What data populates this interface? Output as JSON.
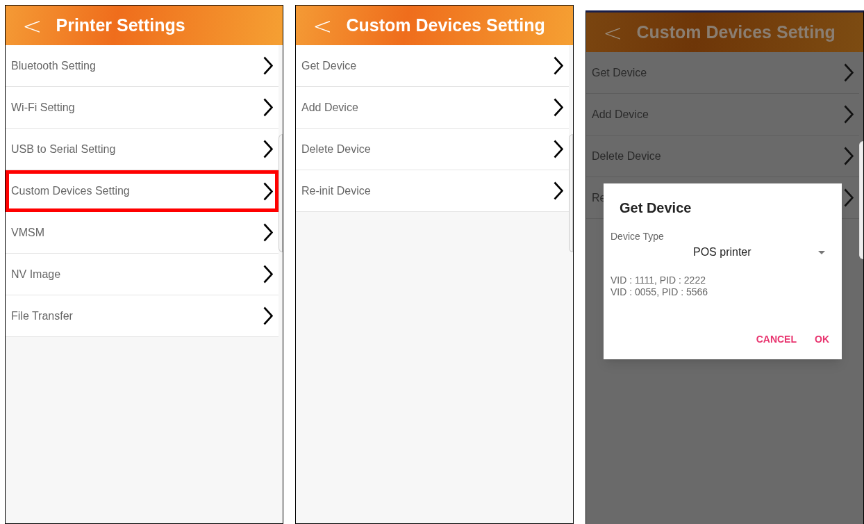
{
  "screens": [
    {
      "title": "Printer Settings",
      "back": "<",
      "dimmed": false,
      "items": [
        {
          "label": "Bluetooth Setting",
          "highlighted": false
        },
        {
          "label": "Wi-Fi Setting",
          "highlighted": false
        },
        {
          "label": "USB to Serial Setting",
          "highlighted": false
        },
        {
          "label": "Custom Devices Setting",
          "highlighted": true
        },
        {
          "label": "VMSM",
          "highlighted": false
        },
        {
          "label": "NV Image",
          "highlighted": false
        },
        {
          "label": "File Transfer",
          "highlighted": false
        }
      ]
    },
    {
      "title": "Custom Devices Setting",
      "back": "<",
      "dimmed": false,
      "items": [
        {
          "label": "Get Device",
          "highlighted": false
        },
        {
          "label": "Add Device",
          "highlighted": false
        },
        {
          "label": "Delete Device",
          "highlighted": false
        },
        {
          "label": "Re-init Device",
          "highlighted": false
        }
      ]
    },
    {
      "title": "Custom Devices Setting",
      "back": "<",
      "dimmed": true,
      "items": [
        {
          "label": "Get Device",
          "highlighted": false
        },
        {
          "label": "Add Device",
          "highlighted": false
        },
        {
          "label": "Delete Device",
          "highlighted": false
        },
        {
          "label": "Re",
          "highlighted": false
        }
      ],
      "dialog": {
        "title": "Get Device",
        "field_label": "Device Type",
        "select_value": "POS printer",
        "lines": [
          "VID : 1111, PID : 2222",
          "VID : 0055, PID : 5566"
        ],
        "buttons": [
          "CANCEL",
          "OK"
        ]
      }
    }
  ]
}
